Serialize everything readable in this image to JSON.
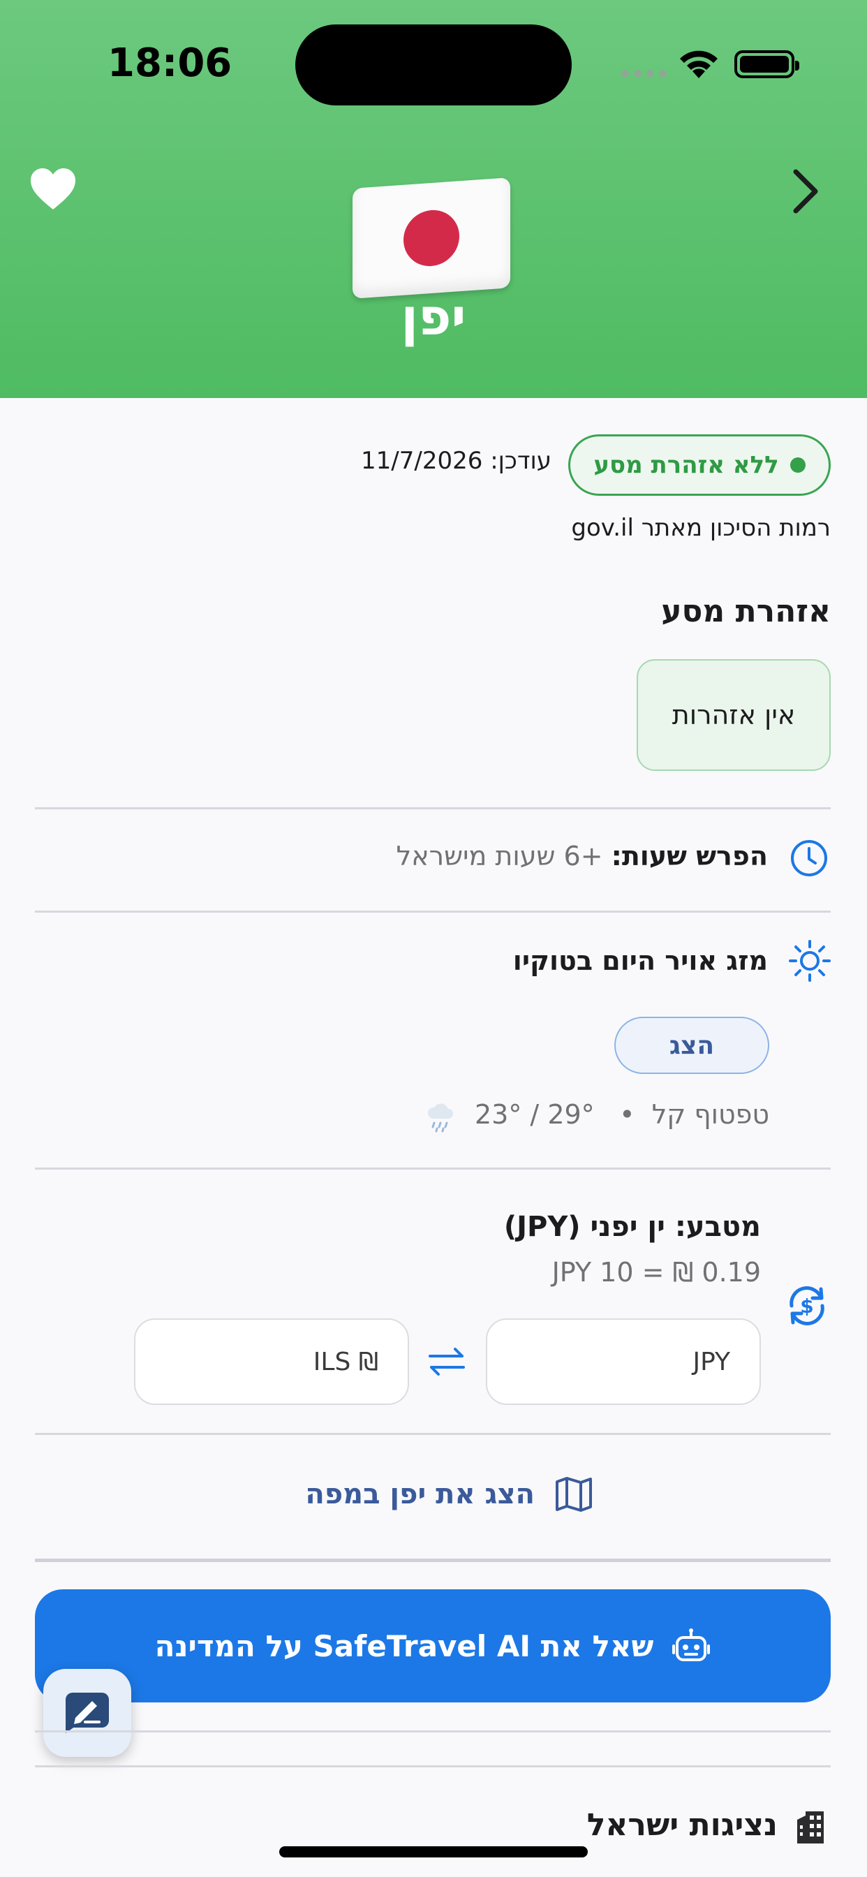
{
  "status_bar": {
    "time": "18:06"
  },
  "header": {
    "country_name": "יפן",
    "bg_color": "#5cc070",
    "icons": {
      "favorite": "heart-icon",
      "forward": "chevron-right-icon",
      "flag": "japan-flag-icon"
    }
  },
  "risk": {
    "badge_label": "ללא אזהרת מסע",
    "updated_label": "עודכן:",
    "updated_date": "11/7/2026",
    "source_text": "רמות הסיכון מאתר gov.il",
    "status_color": "#34a04a"
  },
  "travel_warning": {
    "title": "אזהרת מסע",
    "value": "אין אזהרות"
  },
  "time_difference": {
    "label": "הפרש שעות:",
    "value": "+6 שעות מישראל"
  },
  "weather": {
    "title": "מזג אויר היום בטוקיו",
    "show_button": "הצג",
    "description": "טפטוף קל",
    "separator": "•",
    "temperatures": "23° / 29°"
  },
  "currency": {
    "title": "מטבע: ין יפני (JPY)",
    "rate": "JPY 10 = ₪ 0.19",
    "from_placeholder": "JPY",
    "to_placeholder": "ILS ₪"
  },
  "map": {
    "label": "הצג את יפן במפה"
  },
  "ai": {
    "label": "שאל את SafeTravel AI על המדינה",
    "color": "#1c78e6"
  },
  "embassy": {
    "title": "נציגות ישראל"
  }
}
